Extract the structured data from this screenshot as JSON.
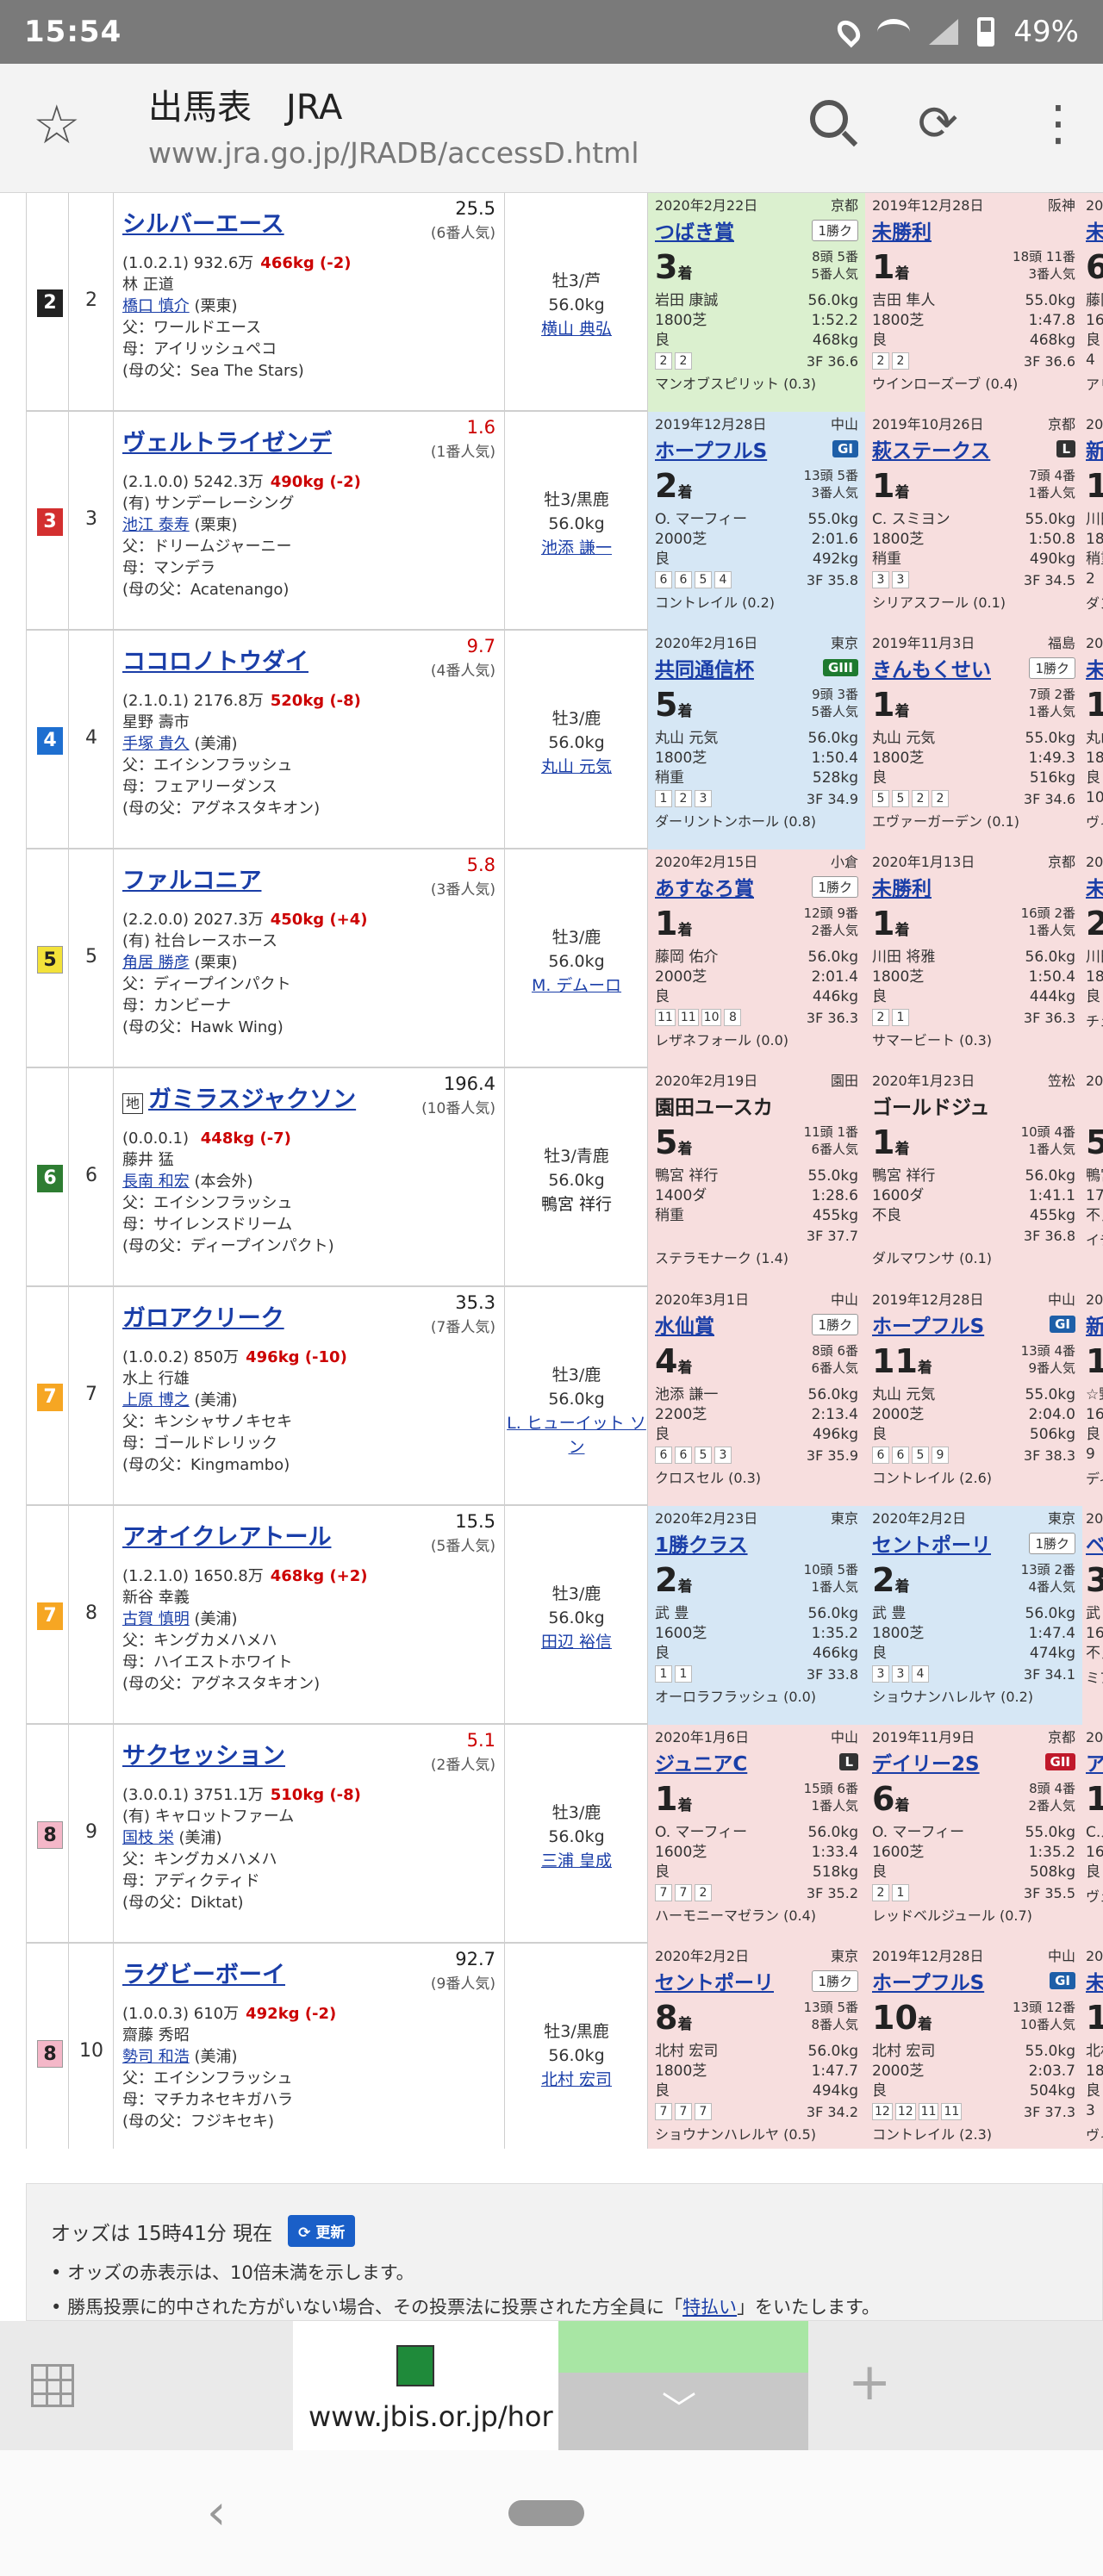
{
  "status": {
    "time": "15:54",
    "battery": "49%"
  },
  "browser": {
    "title": "出馬表　JRA",
    "url": "www.jra.go.jp/JRADB/accessD.html"
  },
  "waku_colors": {
    "2": "#222222",
    "3": "#d32f2f",
    "4": "#1e6fd0",
    "5": "#f3e23a",
    "6": "#2e7d32",
    "7": "#f6a623",
    "8": "#f4b7c8"
  },
  "horses": [
    {
      "waku": "2",
      "umaban": "2",
      "name": "シルバーエース",
      "chiho": "",
      "odds": "25.5",
      "odds_red": false,
      "popular": "(6番人気)",
      "record": "(1.0.2.1)",
      "prize": "932.6万",
      "weight": "466kg (-2)",
      "owner": "林 正道",
      "trainer": "橋口 慎介",
      "stable": "(栗東)",
      "sire": "父：ワールドエース",
      "dam": "母：アイリッシュペコ",
      "damsire": "(母の父：Sea The Stars)",
      "sex_age": "牡3/芦",
      "kinryo": "56.0kg",
      "jockey": "横山 典弘",
      "jockey_link": true,
      "past": [
        {
          "color": "green",
          "date": "2020年2月22日",
          "track": "京都",
          "race": "つばき賞",
          "grade": "1勝ク",
          "grade_type": "cls",
          "link": true,
          "rank": "3",
          "field1": "8頭 5番",
          "field2": "5番人気",
          "jockey": "岩田 康誠",
          "kg": "56.0kg",
          "dist": "1800芝",
          "time": "1:52.2",
          "cond": "良",
          "bw": "468kg",
          "pass": [
            "2",
            "2"
          ],
          "f3": "3F 36.6",
          "winner": "マンオブスピリット (0.3)"
        },
        {
          "color": "pink",
          "date": "2019年12月28日",
          "track": "阪神",
          "race": "未勝利",
          "grade": "",
          "grade_type": "",
          "link": true,
          "rank": "1",
          "field1": "18頭 11番",
          "field2": "3番人気",
          "jockey": "吉田 隼人",
          "kg": "55.0kg",
          "dist": "1800芝",
          "time": "1:47.8",
          "cond": "良",
          "bw": "468kg",
          "pass": [
            "2",
            "2"
          ],
          "f3": "3F 36.6",
          "winner": "ウインローズーブ (0.4)"
        }
      ],
      "third": {
        "date": "2019",
        "race": "未勝",
        "rank": "6",
        "j": "藤岡",
        "d": "1600",
        "c": "良",
        "p": "4",
        "w": "アリ"
      }
    },
    {
      "waku": "3",
      "umaban": "3",
      "name": "ヴェルトライゼンデ",
      "chiho": "",
      "odds": "1.6",
      "odds_red": true,
      "popular": "(1番人気)",
      "record": "(2.1.0.0)",
      "prize": "5242.3万",
      "weight": "490kg (-2)",
      "owner": "(有) サンデーレーシング",
      "trainer": "池江 泰寿",
      "stable": "(栗東)",
      "sire": "父：ドリームジャーニー",
      "dam": "母：マンデラ",
      "damsire": "(母の父：Acatenango)",
      "sex_age": "牡3/黒鹿",
      "kinryo": "56.0kg",
      "jockey": "池添 謙一",
      "jockey_link": true,
      "past": [
        {
          "color": "blue",
          "date": "2019年12月28日",
          "track": "中山",
          "race": "ホープフルS",
          "grade": "GI",
          "grade_type": "GI",
          "link": true,
          "rank": "2",
          "field1": "13頭 5番",
          "field2": "3番人気",
          "jockey": "O. マーフィー",
          "kg": "55.0kg",
          "dist": "2000芝",
          "time": "2:01.6",
          "cond": "良",
          "bw": "492kg",
          "pass": [
            "6",
            "6",
            "5",
            "4"
          ],
          "f3": "3F 35.8",
          "winner": "コントレイル (0.2)"
        },
        {
          "color": "pink",
          "date": "2019年10月26日",
          "track": "京都",
          "race": "萩ステークス",
          "grade": "L",
          "grade_type": "L",
          "link": true,
          "rank": "1",
          "field1": "7頭 4番",
          "field2": "1番人気",
          "jockey": "C. スミヨン",
          "kg": "55.0kg",
          "dist": "1800芝",
          "time": "1:50.8",
          "cond": "稍重",
          "bw": "490kg",
          "pass": [
            "3",
            "3"
          ],
          "f3": "3F 34.5",
          "winner": "シリアスフール (0.1)"
        }
      ],
      "third": {
        "date": "2019",
        "race": "新馬",
        "rank": "1",
        "j": "川田",
        "d": "1800",
        "c": "稍重",
        "p": "2",
        "w": "ダン"
      }
    },
    {
      "waku": "4",
      "umaban": "4",
      "name": "ココロノトウダイ",
      "chiho": "",
      "odds": "9.7",
      "odds_red": true,
      "popular": "(4番人気)",
      "record": "(2.1.0.1)",
      "prize": "2176.8万",
      "weight": "520kg (-8)",
      "owner": "星野 壽市",
      "trainer": "手塚 貴久",
      "stable": "(美浦)",
      "sire": "父：エイシンフラッシュ",
      "dam": "母：フェアリーダンス",
      "damsire": "(母の父：アグネスタキオン)",
      "sex_age": "牡3/鹿",
      "kinryo": "56.0kg",
      "jockey": "丸山 元気",
      "jockey_link": true,
      "past": [
        {
          "color": "blue",
          "date": "2020年2月16日",
          "track": "東京",
          "race": "共同通信杯",
          "grade": "GIII",
          "grade_type": "GIII",
          "link": true,
          "rank": "5",
          "field1": "9頭 3番",
          "field2": "5番人気",
          "jockey": "丸山 元気",
          "kg": "56.0kg",
          "dist": "1800芝",
          "time": "1:50.4",
          "cond": "稍重",
          "bw": "528kg",
          "pass": [
            "1",
            "2",
            "3"
          ],
          "f3": "3F 34.9",
          "winner": "ダーリントンホール (0.8)"
        },
        {
          "color": "pink",
          "date": "2019年11月3日",
          "track": "福島",
          "race": "きんもくせい",
          "grade": "1勝ク",
          "grade_type": "cls",
          "link": true,
          "rank": "1",
          "field1": "7頭 2番",
          "field2": "1番人気",
          "jockey": "丸山 元気",
          "kg": "55.0kg",
          "dist": "1800芝",
          "time": "1:49.3",
          "cond": "良",
          "bw": "516kg",
          "pass": [
            "5",
            "5",
            "2",
            "2"
          ],
          "f3": "3F 34.6",
          "winner": "エヴァーガーデン (0.1)"
        }
      ],
      "third": {
        "date": "2019",
        "race": "未勝",
        "rank": "1",
        "j": "丸山",
        "d": "1800",
        "c": "良",
        "p": "10",
        "w": "ヴィ"
      }
    },
    {
      "waku": "5",
      "umaban": "5",
      "name": "ファルコニア",
      "chiho": "",
      "odds": "5.8",
      "odds_red": true,
      "popular": "(3番人気)",
      "record": "(2.2.0.0)",
      "prize": "2027.3万",
      "weight": "450kg (+4)",
      "owner": "(有) 社台レースホース",
      "trainer": "角居 勝彦",
      "stable": "(栗東)",
      "sire": "父：ディープインパクト",
      "dam": "母：カンビーナ",
      "damsire": "(母の父：Hawk Wing)",
      "sex_age": "牡3/鹿",
      "kinryo": "56.0kg",
      "jockey": "M. デムーロ",
      "jockey_link": true,
      "past": [
        {
          "color": "pink",
          "date": "2020年2月15日",
          "track": "小倉",
          "race": "あすなろ賞",
          "grade": "1勝ク",
          "grade_type": "cls",
          "link": true,
          "rank": "1",
          "field1": "12頭 9番",
          "field2": "2番人気",
          "jockey": "藤岡 佑介",
          "kg": "56.0kg",
          "dist": "2000芝",
          "time": "2:01.4",
          "cond": "良",
          "bw": "446kg",
          "pass": [
            "11",
            "11",
            "10",
            "8"
          ],
          "f3": "3F 36.3",
          "winner": "レザネフォール (0.0)"
        },
        {
          "color": "pink",
          "date": "2020年1月13日",
          "track": "京都",
          "race": "未勝利",
          "grade": "",
          "grade_type": "",
          "link": true,
          "rank": "1",
          "field1": "16頭 2番",
          "field2": "1番人気",
          "jockey": "川田 将雅",
          "kg": "56.0kg",
          "dist": "1800芝",
          "time": "1:50.4",
          "cond": "良",
          "bw": "444kg",
          "pass": [
            "2",
            "1"
          ],
          "f3": "3F 36.3",
          "winner": "サマービート (0.3)"
        }
      ],
      "third": {
        "date": "2019",
        "race": "未勝",
        "rank": "2",
        "j": "川田",
        "d": "1800",
        "c": "良",
        "p": "",
        "w": "チェ"
      }
    },
    {
      "waku": "6",
      "umaban": "6",
      "name": "ガミラスジャクソン",
      "chiho": "地",
      "odds": "196.4",
      "odds_red": false,
      "popular": "(10番人気)",
      "record": "(0.0.0.1)",
      "prize": "",
      "weight": "448kg (-7)",
      "owner": "藤井 猛",
      "trainer": "長南 和宏",
      "stable": "(本会外)",
      "sire": "父：エイシンフラッシュ",
      "dam": "母：サイレンスドリーム",
      "damsire": "(母の父：ディープインパクト)",
      "sex_age": "牡3/青鹿",
      "kinryo": "56.0kg",
      "jockey": "鴨宮 祥行",
      "jockey_link": false,
      "past": [
        {
          "color": "pink",
          "date": "2020年2月19日",
          "track": "園田",
          "race": "園田ユースカ",
          "grade": "",
          "grade_type": "",
          "link": false,
          "rank": "5",
          "field1": "11頭 1番",
          "field2": "6番人気",
          "jockey": "鴨宮 祥行",
          "kg": "55.0kg",
          "dist": "1400ダ",
          "time": "1:28.6",
          "cond": "稍重",
          "bw": "455kg",
          "pass": [],
          "f3": "3F 37.7",
          "winner": "ステラモナーク (1.4)"
        },
        {
          "color": "pink",
          "date": "2020年1月23日",
          "track": "笠松",
          "race": "ゴールドジュ",
          "grade": "",
          "grade_type": "",
          "link": false,
          "rank": "1",
          "field1": "10頭 4番",
          "field2": "1番人気",
          "jockey": "鴨宮 祥行",
          "kg": "56.0kg",
          "dist": "1600ダ",
          "time": "1:41.1",
          "cond": "不良",
          "bw": "455kg",
          "pass": [],
          "f3": "3F 36.8",
          "winner": "ダルマワンサ (0.1)"
        }
      ],
      "third": {
        "date": "2019",
        "race": "",
        "rank": "5",
        "j": "鴨宮",
        "d": "1700",
        "c": "不良",
        "p": "",
        "w": "イチ"
      }
    },
    {
      "waku": "7",
      "umaban": "7",
      "name": "ガロアクリーク",
      "chiho": "",
      "odds": "35.3",
      "odds_red": false,
      "popular": "(7番人気)",
      "record": "(1.0.0.2)",
      "prize": "850万",
      "weight": "496kg (-10)",
      "owner": "水上 行雄",
      "trainer": "上原 博之",
      "stable": "(美浦)",
      "sire": "父：キンシャサノキセキ",
      "dam": "母：ゴールドレリック",
      "damsire": "(母の父：Kingmambo)",
      "sex_age": "牡3/鹿",
      "kinryo": "56.0kg",
      "jockey": "L. ヒューイット ソン",
      "jockey_link": true,
      "past": [
        {
          "color": "pink",
          "date": "2020年3月1日",
          "track": "中山",
          "race": "水仙賞",
          "grade": "1勝ク",
          "grade_type": "cls",
          "link": true,
          "rank": "4",
          "field1": "8頭 6番",
          "field2": "6番人気",
          "jockey": "池添 謙一",
          "kg": "56.0kg",
          "dist": "2200芝",
          "time": "2:13.4",
          "cond": "良",
          "bw": "496kg",
          "pass": [
            "6",
            "6",
            "5",
            "3"
          ],
          "f3": "3F 35.9",
          "winner": "クロスセル (0.3)"
        },
        {
          "color": "pink",
          "date": "2019年12月28日",
          "track": "中山",
          "race": "ホープフルS",
          "grade": "GI",
          "grade_type": "GI",
          "link": true,
          "rank": "11",
          "field1": "13頭 4番",
          "field2": "9番人気",
          "jockey": "丸山 元気",
          "kg": "55.0kg",
          "dist": "2000芝",
          "time": "2:04.0",
          "cond": "良",
          "bw": "506kg",
          "pass": [
            "6",
            "6",
            "5",
            "9"
          ],
          "f3": "3F 38.3",
          "winner": "コントレイル (2.6)"
        }
      ],
      "third": {
        "date": "2019",
        "race": "新馬",
        "rank": "1",
        "j": "☆野",
        "d": "1600",
        "c": "良",
        "p": "9",
        "w": "ディ"
      }
    },
    {
      "waku": "7",
      "umaban": "8",
      "name": "アオイクレアトール",
      "chiho": "",
      "odds": "15.5",
      "odds_red": false,
      "popular": "(5番人気)",
      "record": "(1.2.1.0)",
      "prize": "1650.8万",
      "weight": "468kg (+2)",
      "owner": "新谷 幸義",
      "trainer": "古賀 慎明",
      "stable": "(美浦)",
      "sire": "父：キングカメハメハ",
      "dam": "母：ハイエストホワイト",
      "damsire": "(母の父：アグネスタキオン)",
      "sex_age": "牡3/鹿",
      "kinryo": "56.0kg",
      "jockey": "田辺 裕信",
      "jockey_link": true,
      "past": [
        {
          "color": "blue",
          "date": "2020年2月23日",
          "track": "東京",
          "race": "1勝クラス",
          "grade": "",
          "grade_type": "",
          "link": true,
          "rank": "2",
          "field1": "10頭 5番",
          "field2": "1番人気",
          "jockey": "武 豊",
          "kg": "56.0kg",
          "dist": "1600芝",
          "time": "1:35.2",
          "cond": "良",
          "bw": "466kg",
          "pass": [
            "1",
            "1"
          ],
          "f3": "3F 33.8",
          "winner": "オーロラフラッシュ (0.0)"
        },
        {
          "color": "blue",
          "date": "2020年2月2日",
          "track": "東京",
          "race": "セントポーリ",
          "grade": "1勝ク",
          "grade_type": "cls",
          "link": true,
          "rank": "2",
          "field1": "13頭 2番",
          "field2": "4番人気",
          "jockey": "武 豊",
          "kg": "56.0kg",
          "dist": "1800芝",
          "time": "1:47.4",
          "cond": "良",
          "bw": "474kg",
          "pass": [
            "3",
            "3",
            "4"
          ],
          "f3": "3F 34.1",
          "winner": "ショウナンハレルヤ (0.2)"
        }
      ],
      "third": {
        "date": "2019",
        "race": "ベゴ",
        "rank": "3",
        "j": "武",
        "d": "1600",
        "c": "不良",
        "p": "",
        "w": "ミア"
      }
    },
    {
      "waku": "8",
      "umaban": "9",
      "name": "サクセッション",
      "chiho": "",
      "odds": "5.1",
      "odds_red": true,
      "popular": "(2番人気)",
      "record": "(3.0.0.1)",
      "prize": "3751.1万",
      "weight": "510kg (-8)",
      "owner": "(有) キャロットファーム",
      "trainer": "国枝 栄",
      "stable": "(美浦)",
      "sire": "父：キングカメハメハ",
      "dam": "母：アディクティド",
      "damsire": "(母の父：Diktat)",
      "sex_age": "牡3/鹿",
      "kinryo": "56.0kg",
      "jockey": "三浦 皇成",
      "jockey_link": true,
      "past": [
        {
          "color": "pink",
          "date": "2020年1月6日",
          "track": "中山",
          "race": "ジュニアC",
          "grade": "L",
          "grade_type": "L",
          "link": true,
          "rank": "1",
          "field1": "15頭 6番",
          "field2": "1番人気",
          "jockey": "O. マーフィー",
          "kg": "56.0kg",
          "dist": "1600芝",
          "time": "1:33.4",
          "cond": "良",
          "bw": "518kg",
          "pass": [
            "7",
            "7",
            "2"
          ],
          "f3": "3F 35.2",
          "winner": "ハーモニーマゼラン (0.4)"
        },
        {
          "color": "pink",
          "date": "2019年11月9日",
          "track": "京都",
          "race": "デイリー2S",
          "grade": "GII",
          "grade_type": "GII",
          "link": true,
          "rank": "6",
          "field1": "8頭 4番",
          "field2": "2番人気",
          "jockey": "O. マーフィー",
          "kg": "55.0kg",
          "dist": "1600芝",
          "time": "1:35.2",
          "cond": "良",
          "bw": "508kg",
          "pass": [
            "2",
            "1"
          ],
          "f3": "3F 35.5",
          "winner": "レッドベルジュール (0.7)"
        }
      ],
      "third": {
        "date": "2019",
        "race": "アス",
        "rank": "1",
        "j": "C.ル",
        "d": "1600",
        "c": "良",
        "p": "",
        "w": "ヴェ"
      }
    },
    {
      "waku": "8",
      "umaban": "10",
      "name": "ラグビーボーイ",
      "chiho": "",
      "odds": "92.7",
      "odds_red": false,
      "popular": "(9番人気)",
      "record": "(1.0.0.3)",
      "prize": "610万",
      "weight": "492kg (-2)",
      "owner": "齋藤 秀昭",
      "trainer": "勢司 和浩",
      "stable": "(美浦)",
      "sire": "父：エイシンフラッシュ",
      "dam": "母：マチカネセキガハラ",
      "damsire": "(母の父：フジキセキ)",
      "sex_age": "牡3/黒鹿",
      "kinryo": "56.0kg",
      "jockey": "北村 宏司",
      "jockey_link": true,
      "past": [
        {
          "color": "pink",
          "date": "2020年2月2日",
          "track": "東京",
          "race": "セントポーリ",
          "grade": "1勝ク",
          "grade_type": "cls",
          "link": true,
          "rank": "8",
          "field1": "13頭 5番",
          "field2": "8番人気",
          "jockey": "北村 宏司",
          "kg": "56.0kg",
          "dist": "1800芝",
          "time": "1:47.7",
          "cond": "良",
          "bw": "494kg",
          "pass": [
            "7",
            "7",
            "7"
          ],
          "f3": "3F 34.2",
          "winner": "ショウナンハレルヤ (0.5)"
        },
        {
          "color": "pink",
          "date": "2019年12月28日",
          "track": "中山",
          "race": "ホープフルS",
          "grade": "GI",
          "grade_type": "GI",
          "link": true,
          "rank": "10",
          "field1": "13頭 12番",
          "field2": "10番人気",
          "jockey": "北村 宏司",
          "kg": "55.0kg",
          "dist": "2000芝",
          "time": "2:03.7",
          "cond": "良",
          "bw": "504kg",
          "pass": [
            "12",
            "12",
            "11",
            "11"
          ],
          "f3": "3F 37.3",
          "winner": "コントレイル (2.3)"
        }
      ],
      "third": {
        "date": "2019",
        "race": "未勝",
        "rank": "1",
        "j": "北村",
        "d": "1800",
        "c": "良",
        "p": "3",
        "w": "ヴィ"
      }
    }
  ],
  "notes": {
    "odds_time": "オッズは 15時41分 現在",
    "update_label": "更新",
    "note1": "オッズの赤表示は、10倍未満を示します。",
    "note2_pre": "勝馬投票に的中された方がいない場合、その投票法に投票された方全員に「",
    "note2_link": "特払い",
    "note2_post": "」をいたします。"
  },
  "tabs": {
    "tab1_url": "www.jbis.or.jp/hor"
  },
  "rank_suffix": "着"
}
